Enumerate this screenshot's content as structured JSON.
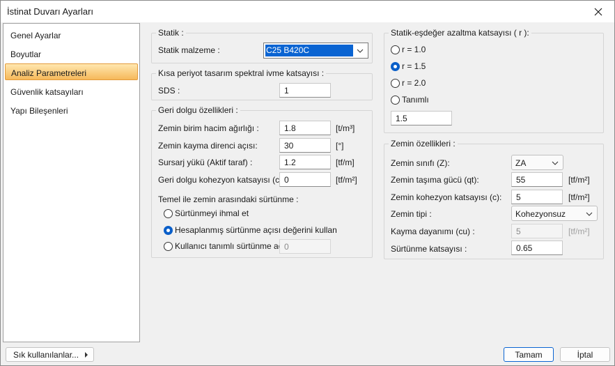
{
  "window": {
    "title": "İstinat Duvarı Ayarları"
  },
  "sidebar": {
    "items": [
      {
        "label": "Genel Ayarlar"
      },
      {
        "label": "Boyutlar"
      },
      {
        "label": "Analiz Parametreleri",
        "selected": true
      },
      {
        "label": "Güvenlik katsayıları"
      },
      {
        "label": "Yapı Bileşenleri"
      }
    ]
  },
  "statik": {
    "legend": "Statik :",
    "material_label": "Statik malzeme :",
    "material_value": "C25 B420C"
  },
  "spectral": {
    "legend": "Kısa periyot tasarım spektral ivme katsayısı :",
    "sds_label": "SDS :",
    "sds_value": "1"
  },
  "backfill": {
    "legend": "Geri dolgu özellikleri :",
    "rows": [
      {
        "label": "Zemin birim hacim ağırlığı :",
        "value": "1.8",
        "unit": "[t/m³]"
      },
      {
        "label": "Zemin kayma direnci açısı:",
        "value": "30",
        "unit": "[°]"
      },
      {
        "label": "Sursarj yükü (Aktif taraf) :",
        "value": "1.2",
        "unit": "[tf/m]"
      },
      {
        "label": "Geri dolgu kohezyon katsayısı (cd)",
        "value": "0",
        "unit": "[tf/m²]"
      }
    ],
    "friction_title": "Temel ile zemin arasındaki sürtünme :",
    "friction_options": [
      {
        "label": "Sürtünmeyi ihmal et",
        "selected": false
      },
      {
        "label": "Hesaplanmış sürtünme açısı değerini kullan",
        "selected": true
      },
      {
        "label": "Kullanıcı tanımlı sürtünme açısı :",
        "selected": false
      }
    ],
    "custom_angle_value": "0"
  },
  "reduction": {
    "legend": "Statik-eşdeğer azaltma katsayısı ( r ):",
    "options": [
      {
        "label": "r = 1.0",
        "selected": false
      },
      {
        "label": "r = 1.5",
        "selected": true
      },
      {
        "label": "r = 2.0",
        "selected": false
      },
      {
        "label": "Tanımlı",
        "selected": false
      }
    ],
    "custom_value": "1.5"
  },
  "soil": {
    "legend": "Zemin özellikleri :",
    "class_label": "Zemin sınıfı (Z):",
    "class_value": "ZA",
    "bearing_label": "Zemin taşıma gücü (qt):",
    "bearing_value": "55",
    "bearing_unit": "[tf/m²]",
    "cohesion_label": "Zemin kohezyon katsayısı (c):",
    "cohesion_value": "5",
    "cohesion_unit": "[tf/m²]",
    "type_label": "Zemin tipi :",
    "type_value": "Kohezyonsuz",
    "shear_label": "Kayma dayanımı (cu) :",
    "shear_value": "5",
    "shear_unit": "[tf/m²]",
    "friction_label": "Sürtünme katsayısı :",
    "friction_value": "0.65"
  },
  "footer": {
    "favorites_label": "Sık kullanılanlar...",
    "ok_label": "Tamam",
    "cancel_label": "İptal"
  },
  "colors": {
    "accent": "#0a64d2",
    "selection_gradient_top": "#ffe7b0",
    "selection_gradient_bottom": "#f6b95a"
  }
}
